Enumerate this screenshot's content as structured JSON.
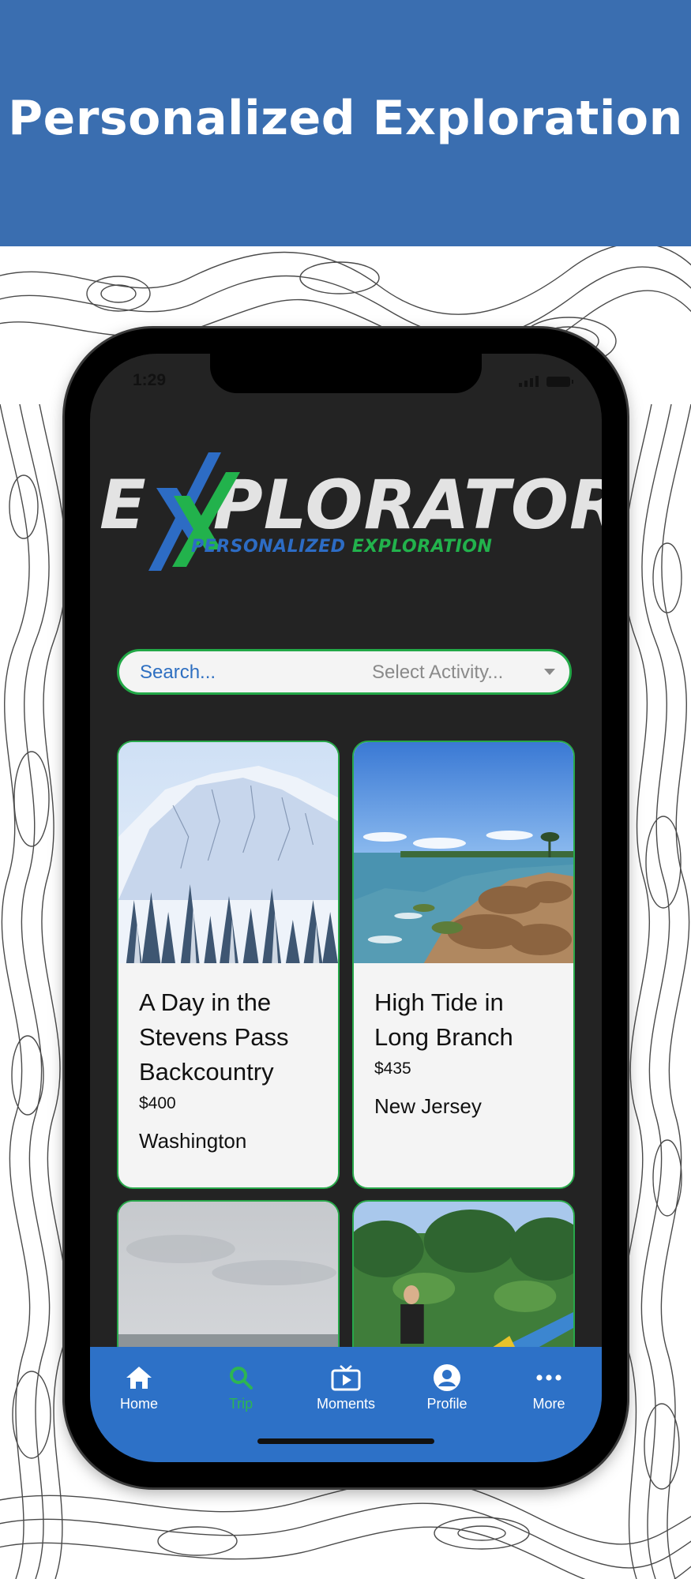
{
  "banner": {
    "title": "Personalized Exploration"
  },
  "status_bar": {
    "time": "1:29"
  },
  "logo": {
    "word_left": "E",
    "word_right": "PLORATOR",
    "tagline_part1": "PERSONALIZED",
    "tagline_part2": "EXPLORATION"
  },
  "search": {
    "placeholder": "Search...",
    "activity_select": "Select Activity..."
  },
  "cards": [
    {
      "title": "A Day in the Stevens Pass Backcountry",
      "price": "$400",
      "region": "Washington"
    },
    {
      "title": "High Tide in Long Branch",
      "price": "$435",
      "region": "New Jersey"
    }
  ],
  "tabbar": {
    "items": [
      {
        "label": "Home",
        "icon": "home-icon"
      },
      {
        "label": "Trip",
        "icon": "search-icon"
      },
      {
        "label": "Moments",
        "icon": "tv-icon"
      },
      {
        "label": "Profile",
        "icon": "user-icon"
      },
      {
        "label": "More",
        "icon": "more-icon"
      }
    ],
    "active_index": 1
  },
  "colors": {
    "banner": "#3a6eb0",
    "accent_green": "#22a847",
    "accent_blue": "#2d71c7",
    "screen_bg": "#232323"
  }
}
